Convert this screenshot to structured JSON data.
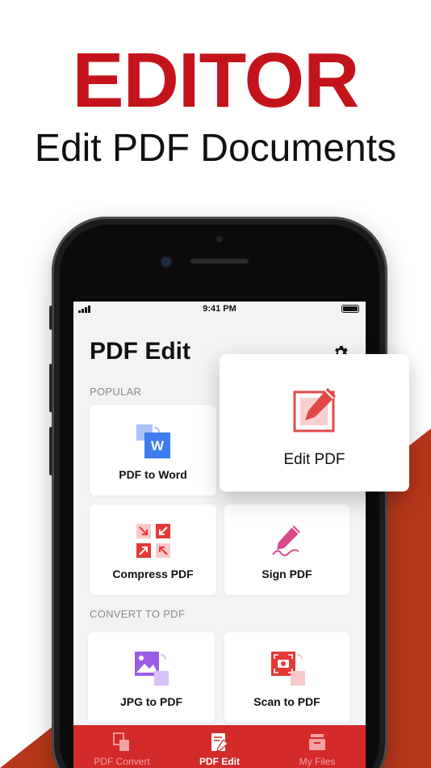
{
  "headline": "EDITOR",
  "subhead": "Edit PDF Documents",
  "status_bar": {
    "time": "9:41 PM"
  },
  "screen": {
    "title": "PDF Edit",
    "settings_icon": "gear-icon",
    "sections": [
      {
        "label": "POPULAR",
        "tools": [
          "PDF to Word",
          "Compress PDF",
          "Sign PDF"
        ]
      },
      {
        "label": "CONVERT TO PDF",
        "tools": [
          "JPG to PDF",
          "Scan to PDF"
        ]
      }
    ]
  },
  "featured_card": {
    "label": "Edit PDF",
    "icon": "edit-pdf-icon"
  },
  "tabbar": {
    "tabs": [
      {
        "label": "PDF Convert",
        "icon": "pdf-convert-icon",
        "active": false
      },
      {
        "label": "PDF Edit",
        "icon": "pdf-edit-icon",
        "active": true
      },
      {
        "label": "My Files",
        "icon": "files-icon",
        "active": false
      }
    ]
  },
  "colors": {
    "brand_red": "#c4141b",
    "tab_bar": "#d32a2a",
    "accent_rust": "#b6371b",
    "word_blue": "#3d7bf0",
    "purple": "#9b5de5",
    "pink": "#d94a8c"
  }
}
